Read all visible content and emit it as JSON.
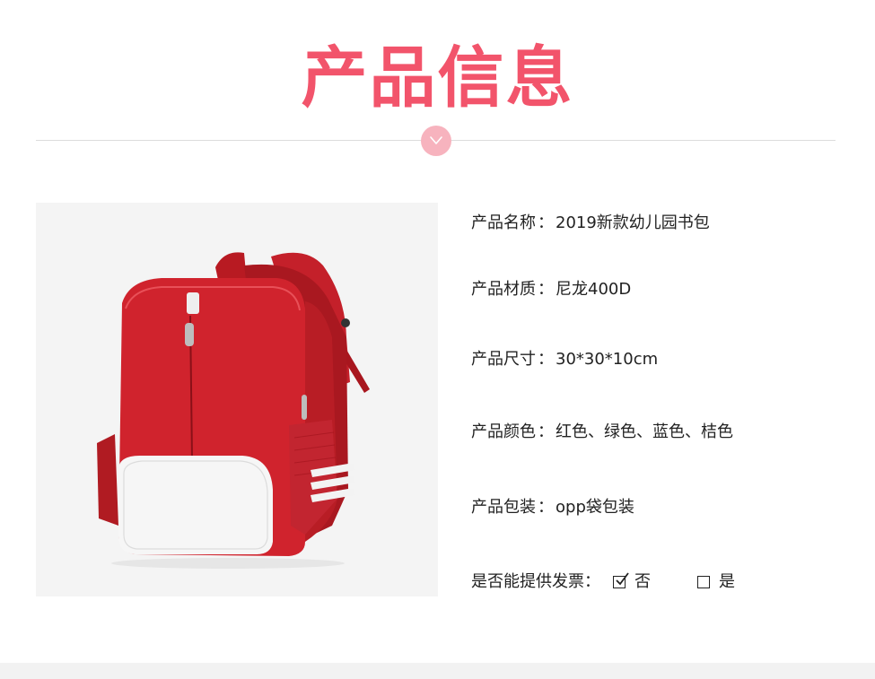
{
  "colors": {
    "accent": "#f2546b",
    "badge": "#f7b3be"
  },
  "title": "产品信息",
  "divider": {
    "icon": "chevron-down-icon"
  },
  "product_image": {
    "subject": "red-backpack"
  },
  "specs": [
    {
      "label": "产品名称",
      "value": "2019新款幼儿园书包"
    },
    {
      "label": "产品材质",
      "value": "尼龙400D"
    },
    {
      "label": "产品尺寸",
      "value": "30*30*10cm"
    },
    {
      "label": "产品颜色",
      "value": "红色、绿色、蓝色、桔色"
    },
    {
      "label": "产品包装",
      "value": "opp袋包装"
    }
  ],
  "invoice": {
    "label": "是否能提供发票：",
    "option_no": "否",
    "option_yes": "是",
    "selected": "否"
  },
  "separator": "："
}
